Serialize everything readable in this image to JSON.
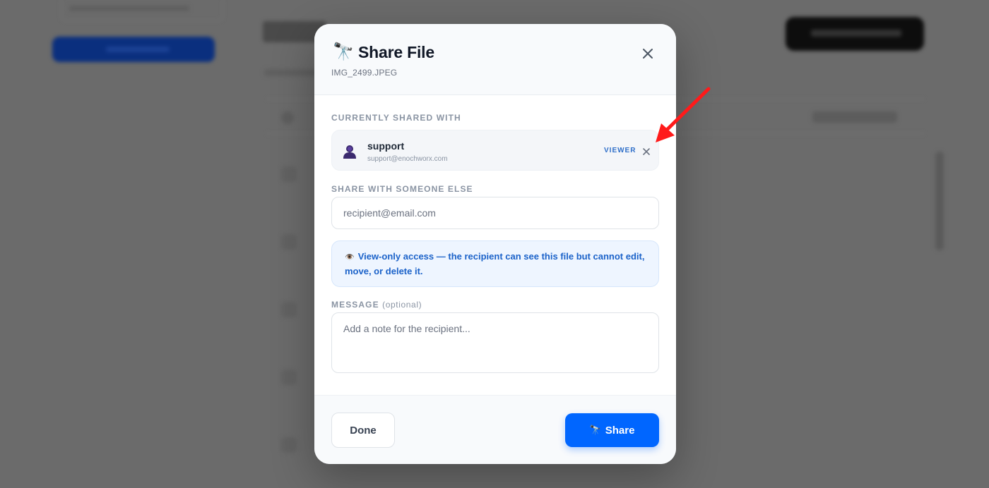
{
  "modal": {
    "title_emoji": "🔭",
    "title": "Share File",
    "filename": "IMG_2499.JPEG",
    "close_icon": "close-icon"
  },
  "currently_shared": {
    "label": "CURRENTLY SHARED WITH",
    "users": [
      {
        "name": "support",
        "email": "support@enochworx.com",
        "role": "VIEWER",
        "avatar_icon": "user-icon",
        "remove_icon": "close-icon"
      }
    ]
  },
  "share_with": {
    "label": "SHARE WITH SOMEONE ELSE",
    "input_placeholder": "recipient@email.com",
    "input_value": ""
  },
  "info": {
    "icon": "👁️",
    "text": "View-only access — the recipient can see this file but cannot edit, move, or delete it."
  },
  "message": {
    "label": "MESSAGE",
    "optional_label": "(optional)",
    "placeholder": "Add a note for the recipient...",
    "value": ""
  },
  "footer": {
    "done_label": "Done",
    "share_emoji": "🔭",
    "share_label": "Share"
  },
  "colors": {
    "accent": "#0066ff",
    "info_text": "#1b62c9",
    "annotation_arrow": "#ff1a1a"
  }
}
